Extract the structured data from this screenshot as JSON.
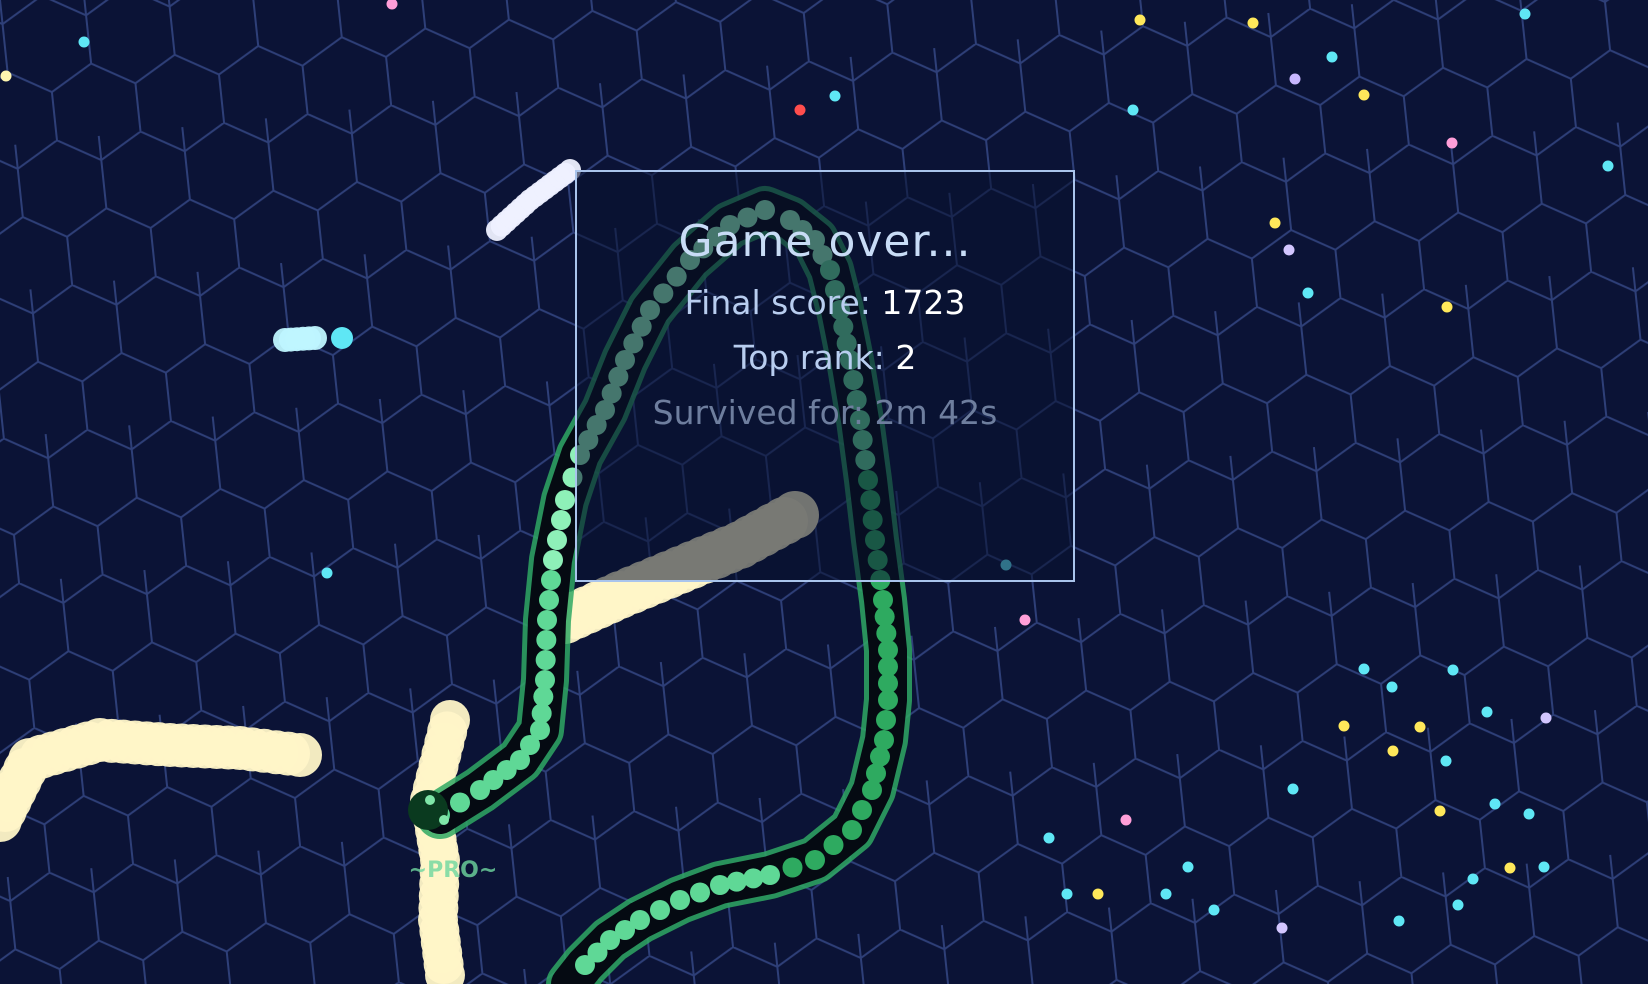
{
  "game_over": {
    "title": "Game over...",
    "final_score_label": "Final score:",
    "final_score": "1723",
    "top_rank_label": "Top rank:",
    "top_rank": "2",
    "survived_label": "Survived for:",
    "survived": "2m 42s"
  },
  "player": {
    "nickname": "~PRO~"
  },
  "colors": {
    "background": "#0b1336",
    "hex_grid": "#2e3f78",
    "panel_border": "#a9c4ec",
    "player_snake": "#3ac07a",
    "enemy_snake_yellow": "#fff6c8",
    "enemy_snake_white": "#eef0ff",
    "enemy_snake_cyan": "#bff6ff"
  }
}
